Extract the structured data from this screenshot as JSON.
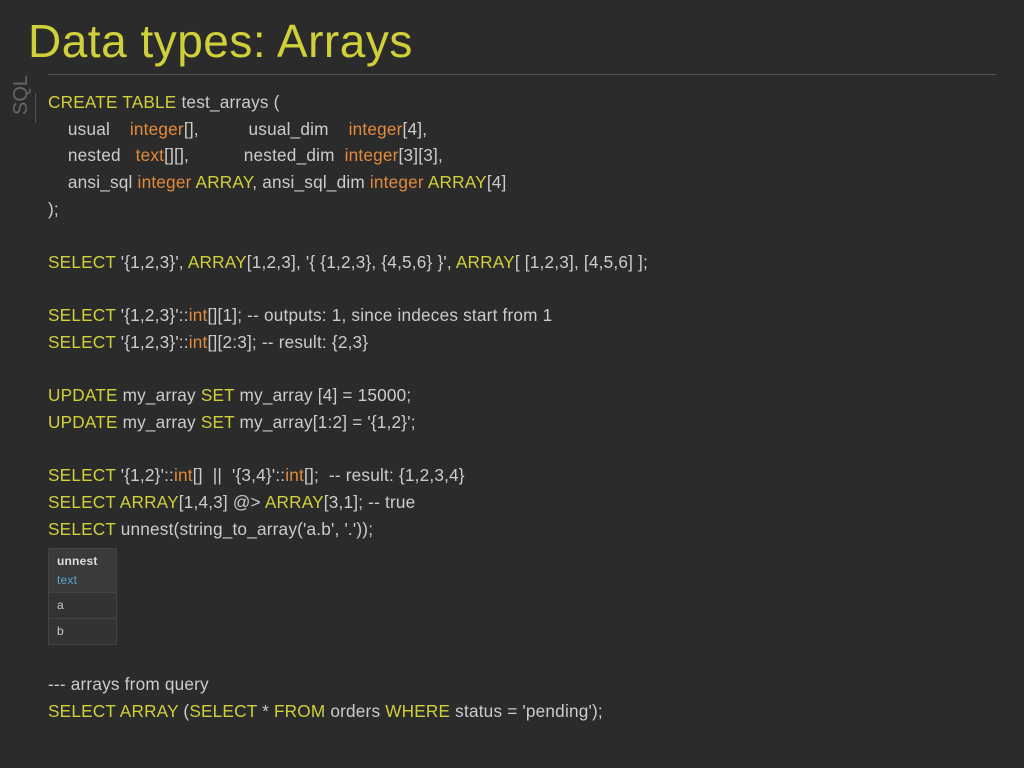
{
  "title": "Data types: Arrays",
  "sidebar_label": "SQL",
  "table": {
    "header": "unnest",
    "subheader": "text",
    "rows": [
      "a",
      "b"
    ]
  },
  "code": {
    "l1a": "CREATE TABLE",
    "l1b": " test_arrays (",
    "l2a": "    usual    ",
    "l2b": "integer",
    "l2c": "[],          usual_dim    ",
    "l2d": "integer",
    "l2e": "[4],",
    "l3a": "    nested   ",
    "l3b": "text",
    "l3c": "[][],           nested_dim  ",
    "l3d": "integer",
    "l3e": "[3][3],",
    "l4a": "    ansi_sql ",
    "l4b": "integer",
    "l4c": " ARRAY",
    "l4d": ", ansi_sql_dim ",
    "l4e": "integer",
    "l4f": " ARRAY",
    "l4g": "[4]",
    "l5a": ");",
    "l6a": "SELECT",
    "l6b": " '{1,2,3}', ",
    "l6c": "ARRAY",
    "l6d": "[1,2,3], '{ {1,2,3}, {4,5,6} }', ",
    "l6e": "ARRAY",
    "l6f": "[ [1,2,3], [4,5,6] ];",
    "l7a": "SELECT",
    "l7b": " '{1,2,3}'::",
    "l7c": "int",
    "l7d": "[][1]; -- outputs: 1, since indeces start from 1",
    "l8a": "SELECT",
    "l8b": " '{1,2,3}'::",
    "l8c": "int",
    "l8d": "[][2:3]; -- result: {2,3}",
    "l9a": "UPDATE",
    "l9b": " my_array ",
    "l9c": "SET",
    "l9d": " my_array [4] = 15000;",
    "l10a": "UPDATE",
    "l10b": " my_array ",
    "l10c": "SET",
    "l10d": " my_array[1:2] = '{1,2}';",
    "l11a": "SELECT",
    "l11b": " '{1,2}'::",
    "l11c": "int",
    "l11d": "[]  ||  '{3,4}'::",
    "l11e": "int",
    "l11f": "[];  -- result: {1,2,3,4}",
    "l12a": "SELECT",
    "l12b": " ARRAY",
    "l12c": "[1,4,3] @> ",
    "l12d": "ARRAY",
    "l12e": "[3,1]; -- true",
    "l13a": "SELECT",
    "l13b": " unnest",
    "l13c": "(string_to_array('a.b', '.'));",
    "l14a": "--- arrays from query",
    "l15a": "SELECT",
    "l15b": " ARRAY",
    "l15c": " (",
    "l15d": "SELECT",
    "l15e": " * ",
    "l15f": "FROM",
    "l15g": " orders ",
    "l15h": "WHERE",
    "l15i": " status = 'pending');"
  }
}
